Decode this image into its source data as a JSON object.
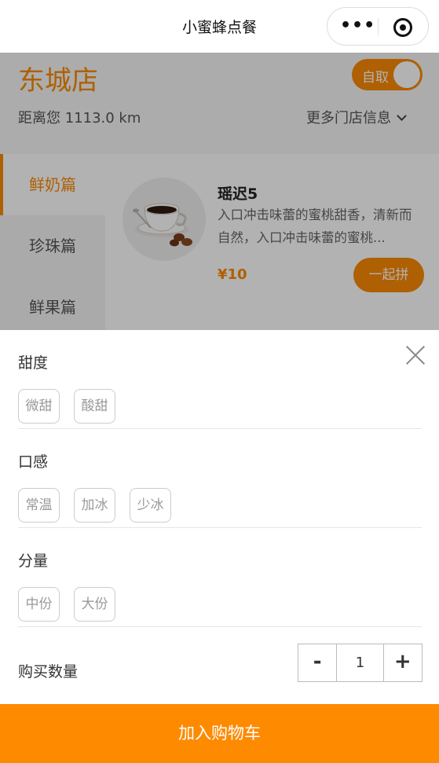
{
  "navbar": {
    "title": "小蜜蜂点餐",
    "more_glyph": "•••",
    "more_icon": "more-dots-icon",
    "close_icon": "target-icon"
  },
  "store": {
    "name": "东城店",
    "pickup_toggle_label": "自取",
    "distance": "距离您 1113.0 km",
    "more_info": "更多门店信息",
    "accent_color": "#f98a04"
  },
  "categories": [
    {
      "label": "鲜奶篇",
      "active": true
    },
    {
      "label": "珍珠篇",
      "active": false
    },
    {
      "label": "鲜果篇",
      "active": false
    }
  ],
  "product": {
    "name": "瑶迟5",
    "desc": "入口冲击味蕾的蜜桃甜香，清新而自然，入口冲击味蕾的蜜桃...",
    "price": "¥10",
    "group_button": "一起拼",
    "image_icon": "coffee-cup-icon"
  },
  "specs": [
    {
      "title": "甜度",
      "options": [
        "微甜",
        "酸甜"
      ]
    },
    {
      "title": "口感",
      "options": [
        "常温",
        "加冰",
        "少冰"
      ]
    },
    {
      "title": "分量",
      "options": [
        "中份",
        "大份"
      ]
    }
  ],
  "quantity": {
    "label": "购买数量",
    "minus": "-",
    "value": "1",
    "plus": "+"
  },
  "cart_button": "加入购物车"
}
